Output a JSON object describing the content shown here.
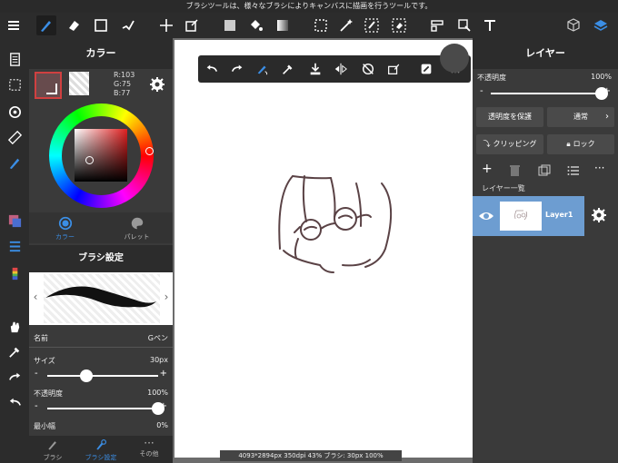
{
  "top_message": "ブラシツールは、様々なブラシによりキャンバスに描画を行うツールです。",
  "color_panel": {
    "title": "カラー",
    "rgb": {
      "r": "R:103",
      "g": "G:75",
      "b": "B:77"
    },
    "tabs": [
      "カラー",
      "パレット"
    ]
  },
  "brush_panel": {
    "title": "ブラシ設定",
    "name_label": "名前",
    "name_value": "Gペン",
    "size_label": "サイズ",
    "size_value": "30px",
    "size_fraction": 0.35,
    "opacity_label": "不透明度",
    "opacity_value": "100%",
    "opacity_fraction": 1.0,
    "min_width_label": "最小幅",
    "min_width_value": "0%"
  },
  "bottom_tabs": [
    "ブラシ",
    "ブラシ設定",
    "その他"
  ],
  "status_bar": "4093*2894px 350dpi 43% ブラシ: 30px 100%",
  "layer_panel": {
    "title": "レイヤー",
    "opacity_label": "不透明度",
    "opacity_value": "100%",
    "opacity_fraction": 1.0,
    "protect_button": "透明度を保護",
    "blend_mode": "通常",
    "clipping_button": "クリッピング",
    "lock_button": "ロック",
    "list_label": "レイヤー一覧",
    "layers": [
      {
        "name": "Layer1"
      }
    ]
  },
  "colors": {
    "current_color": "#674b4d",
    "layer_selected": "#6d9dd1",
    "accent": "#3b8ee5",
    "stroke": "#5a4245"
  },
  "icons": {
    "toolbar": [
      "menu-icon",
      "pen-icon",
      "eraser-icon",
      "rectangle-icon",
      "brush-icon",
      "move-icon",
      "transform-icon",
      "fill-color-icon",
      "bucket-icon",
      "gradient-icon",
      "selection-icon",
      "magic-wand-icon",
      "select-pen-icon",
      "select-eraser-icon",
      "panel-icon",
      "operate-icon",
      "text-icon",
      "3d-icon",
      "layers-icon"
    ],
    "floating": [
      "undo-icon",
      "redo-icon",
      "stabilizer-icon",
      "eyedropper-icon",
      "save-icon",
      "flip-icon",
      "snap-off-icon",
      "clear-icon",
      "fit-icon",
      "grid-icon"
    ]
  }
}
